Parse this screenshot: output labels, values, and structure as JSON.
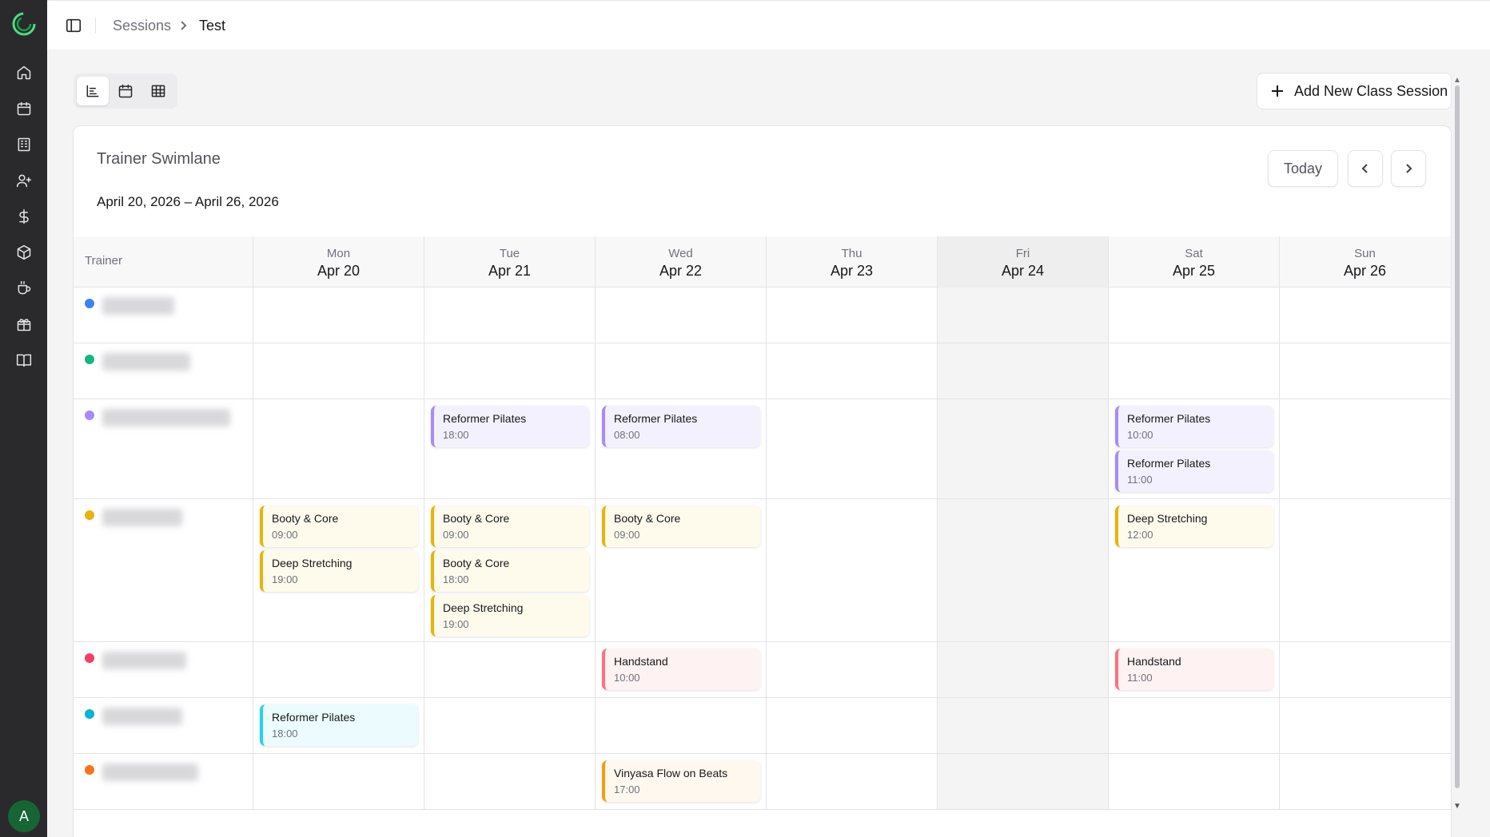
{
  "nav": [
    {
      "name": "home-icon"
    },
    {
      "name": "calendar-icon"
    },
    {
      "name": "building-icon"
    },
    {
      "name": "user-plus-icon"
    },
    {
      "name": "dollar-icon"
    },
    {
      "name": "package-icon"
    },
    {
      "name": "coffee-cup-icon"
    },
    {
      "name": "gift-icon"
    },
    {
      "name": "book-icon"
    }
  ],
  "avatar_initial": "A",
  "breadcrumb": {
    "parent": "Sessions",
    "current": "Test"
  },
  "toolbar": {
    "add_label": "Add New Class Session"
  },
  "card": {
    "title": "Trainer Swimlane",
    "date_range": "April 20, 2026 – April 26, 2026",
    "today_label": "Today"
  },
  "grid": {
    "trainer_header": "Trainer",
    "days": [
      {
        "name": "Mon",
        "date": "Apr 20"
      },
      {
        "name": "Tue",
        "date": "Apr 21"
      },
      {
        "name": "Wed",
        "date": "Apr 22"
      },
      {
        "name": "Thu",
        "date": "Apr 23"
      },
      {
        "name": "Fri",
        "date": "Apr 24",
        "today": true
      },
      {
        "name": "Sat",
        "date": "Apr 25"
      },
      {
        "name": "Sun",
        "date": "Apr 26"
      }
    ]
  },
  "trainers": [
    {
      "color": "#3b82f6",
      "events": []
    },
    {
      "color": "#10b981",
      "events": []
    },
    {
      "color": "#a78bfa",
      "events": [
        {
          "day": 1,
          "name": "Reformer Pilates",
          "time": "18:00",
          "style": "purple"
        },
        {
          "day": 2,
          "name": "Reformer Pilates",
          "time": "08:00",
          "style": "purple"
        },
        {
          "day": 5,
          "name": "Reformer Pilates",
          "time": "10:00",
          "style": "purple"
        },
        {
          "day": 5,
          "name": "Reformer Pilates",
          "time": "11:00",
          "style": "purple"
        }
      ]
    },
    {
      "color": "#eab308",
      "events": [
        {
          "day": 0,
          "name": "Booty & Core",
          "time": "09:00",
          "style": "yellow"
        },
        {
          "day": 0,
          "name": "Deep Stretching",
          "time": "19:00",
          "style": "yellow"
        },
        {
          "day": 1,
          "name": "Booty & Core",
          "time": "09:00",
          "style": "yellow"
        },
        {
          "day": 1,
          "name": "Booty & Core",
          "time": "18:00",
          "style": "yellow"
        },
        {
          "day": 1,
          "name": "Deep Stretching",
          "time": "19:00",
          "style": "yellow"
        },
        {
          "day": 2,
          "name": "Booty & Core",
          "time": "09:00",
          "style": "yellow"
        },
        {
          "day": 5,
          "name": "Deep Stretching",
          "time": "12:00",
          "style": "yellow"
        }
      ]
    },
    {
      "color": "#f43f5e",
      "events": [
        {
          "day": 2,
          "name": "Handstand",
          "time": "10:00",
          "style": "red"
        },
        {
          "day": 5,
          "name": "Handstand",
          "time": "11:00",
          "style": "red"
        }
      ]
    },
    {
      "color": "#06b6d4",
      "events": [
        {
          "day": 0,
          "name": "Reformer Pilates",
          "time": "18:00",
          "style": "cyan"
        }
      ]
    },
    {
      "color": "#f97316",
      "events": [
        {
          "day": 2,
          "name": "Vinyasa Flow on Beats",
          "time": "17:00",
          "style": "orange"
        }
      ]
    }
  ]
}
